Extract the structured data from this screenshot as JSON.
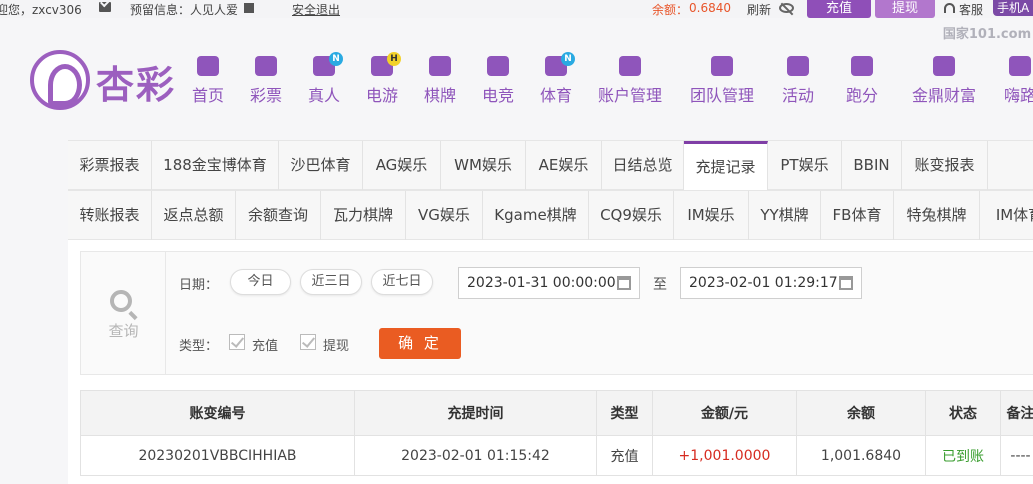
{
  "topbar": {
    "greeting": "迎您，zxcv306",
    "reserve": "预留信息：人见人爱",
    "logout": "安全退出",
    "balance_label": "余额：",
    "balance_value": "0.6840",
    "refresh": "刷新",
    "deposit": "充值",
    "withdraw": "提现",
    "service": "客服",
    "mobile": "手机A",
    "watermark": "国家101.com"
  },
  "logo_text": "杏彩",
  "nav": [
    {
      "label": "首页",
      "icon": "home-icon"
    },
    {
      "label": "彩票",
      "icon": "lottery-icon"
    },
    {
      "label": "真人",
      "icon": "live-icon",
      "badge": "N"
    },
    {
      "label": "电游",
      "icon": "gamepad-icon",
      "badge": "H"
    },
    {
      "label": "棋牌",
      "icon": "cards-icon"
    },
    {
      "label": "电竞",
      "icon": "esports-icon"
    },
    {
      "label": "体育",
      "icon": "trophy-icon",
      "badge": "N"
    },
    {
      "label": "账户管理",
      "icon": "account-icon"
    },
    {
      "label": "团队管理",
      "icon": "team-icon"
    },
    {
      "label": "活动",
      "icon": "gift-icon"
    },
    {
      "label": "跑分",
      "icon": "run-icon"
    },
    {
      "label": "金鼎财富",
      "icon": "wealth-icon"
    },
    {
      "label": "嗨路",
      "icon": "hi-icon"
    }
  ],
  "tabs_row1": [
    "彩票报表",
    "188金宝博体育",
    "沙巴体育",
    "AG娱乐",
    "WM娱乐",
    "AE娱乐",
    "日结总览",
    "充提记录",
    "PT娱乐",
    "BBIN",
    "账变报表"
  ],
  "tabs_row2": [
    "转账报表",
    "返点总额",
    "余额查询",
    "瓦力棋牌",
    "VG娱乐",
    "Kgame棋牌",
    "CQ9娱乐",
    "IM娱乐",
    "YY棋牌",
    "FB体育",
    "特兔棋牌",
    "IM体育"
  ],
  "filter": {
    "query": "查询",
    "date_label": "日期：",
    "today": "今日",
    "three_days": "近三日",
    "seven_days": "近七日",
    "start": "2023-01-31 00:00:00",
    "to": "至",
    "end": "2023-02-01 01:29:17",
    "type_label": "类型：",
    "type_deposit": "充值",
    "type_withdraw": "提现",
    "confirm": "确 定"
  },
  "table": {
    "headers": [
      "账变编号",
      "充提时间",
      "类型",
      "金额/元",
      "余额",
      "状态",
      "备注"
    ],
    "rows": [
      [
        "20230201VBBCIHHIAB",
        "2023-02-01 01:15:42",
        "充值",
        "+1,001.0000",
        "1,001.6840",
        "已到账",
        "----"
      ]
    ]
  },
  "colors": {
    "accent": "#8f55bb",
    "deposit_btn": "#8f4fb8",
    "confirm_btn": "#ea5c22",
    "amount": "#d62b20",
    "status_ok": "#3a9d2f"
  }
}
